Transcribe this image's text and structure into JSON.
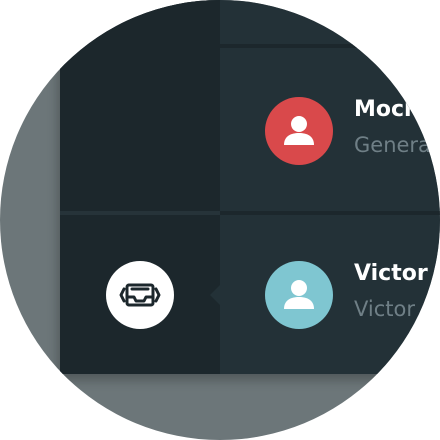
{
  "colors": {
    "backdrop": "#6c7679",
    "window_bg": "#233137",
    "sidebar_bg": "#1c272c",
    "avatar_red": "#d9494b",
    "avatar_teal": "#7fc6d1",
    "name_text": "#ffffff",
    "sub_text": "#6f7f86"
  },
  "sidebar": {
    "active_item": {
      "icon": "inbox-tray-icon"
    }
  },
  "contacts": [
    {
      "name": "Moch",
      "subtitle": "Genera",
      "avatar_icon": "user-silhouette-icon",
      "avatar_color": "#d9494b"
    },
    {
      "name": "Victor E",
      "subtitle": "Victor",
      "avatar_icon": "user-silhouette-icon",
      "avatar_color": "#7fc6d1"
    }
  ]
}
